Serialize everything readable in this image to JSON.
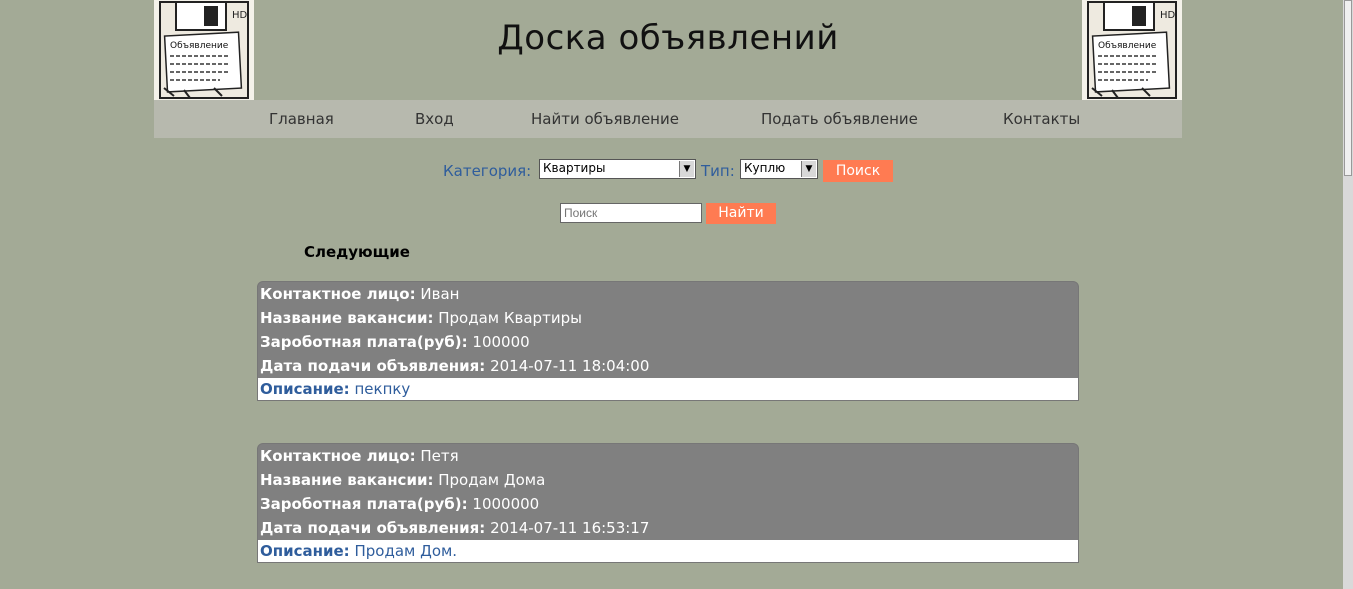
{
  "header": {
    "title": "Доска объявлений",
    "logo_text": "Объявление"
  },
  "nav": [
    "Главная",
    "Вход",
    "Найти объявление",
    "Подать объявление",
    "Контакты"
  ],
  "filter": {
    "category_label": "Категория:",
    "category_value": "Квартиры",
    "type_label": "Тип:",
    "type_value": "Куплю",
    "search_button": "Поиск"
  },
  "search": {
    "placeholder": "Поиск",
    "button": "Найти"
  },
  "next_label": "Следующие",
  "listings": [
    {
      "contact_label": "Контактное лицо:",
      "contact": "Иван",
      "title_label": "Название вакансии:",
      "title": "Продам Квартиры",
      "salary_label": "Зароботная плата(руб):",
      "salary": "100000",
      "date_label": "Дата подачи объявления:",
      "date": "2014-07-11 18:04:00",
      "desc_label": "Описание:",
      "desc": "пекпку"
    },
    {
      "contact_label": "Контактное лицо:",
      "contact": "Петя",
      "title_label": "Название вакансии:",
      "title": "Продам Дома",
      "salary_label": "Зароботная плата(руб):",
      "salary": "1000000",
      "date_label": "Дата подачи объявления:",
      "date": "2014-07-11 16:53:17",
      "desc_label": "Описание:",
      "desc": "Продам Дом."
    }
  ]
}
